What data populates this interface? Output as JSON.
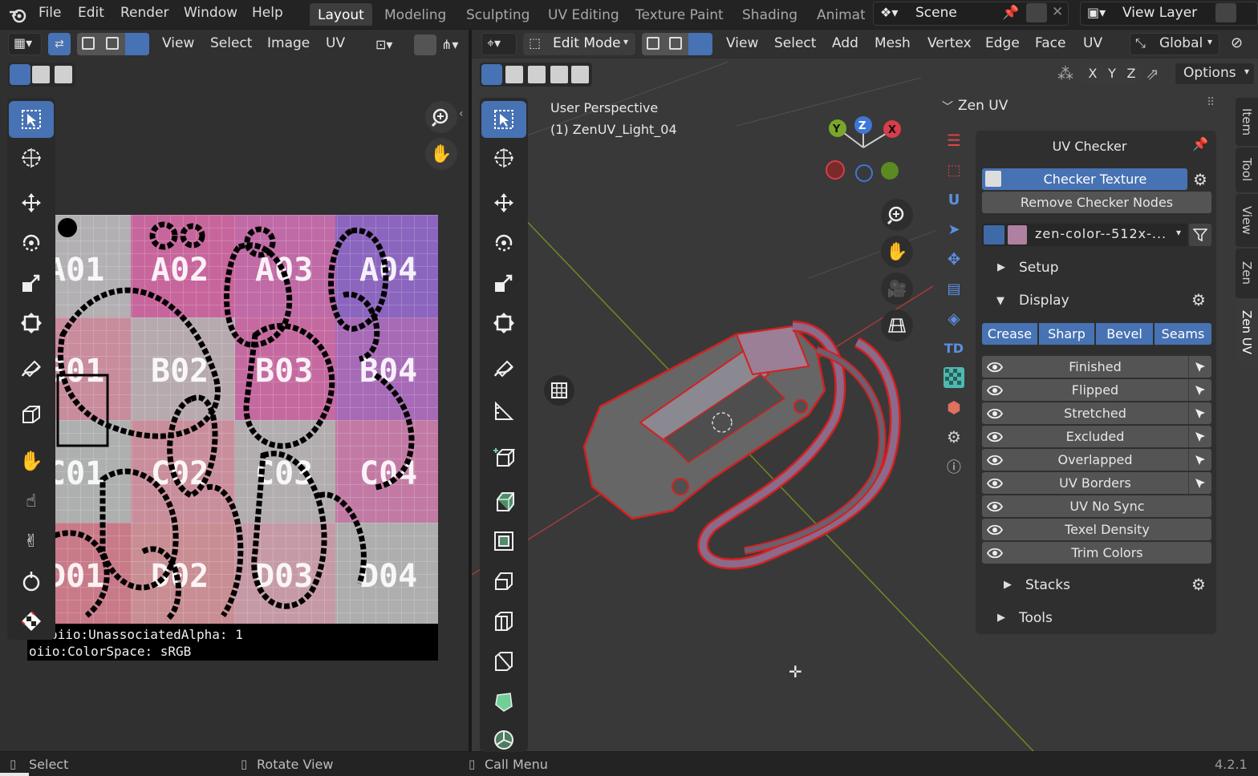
{
  "menubar": {
    "items": [
      "File",
      "Edit",
      "Render",
      "Window",
      "Help"
    ],
    "workspaces": [
      "Layout",
      "Modeling",
      "Sculpting",
      "UV Editing",
      "Texture Paint",
      "Shading",
      "Animati"
    ],
    "scene": "Scene",
    "view_layer": "View Layer"
  },
  "uv_editor": {
    "menus": [
      "View",
      "Select",
      "Image",
      "UV"
    ],
    "tile_labels": [
      "A01",
      "A02",
      "A03",
      "A04",
      "B01",
      "B02",
      "B03",
      "B04",
      "C01",
      "C02",
      "C03",
      "C04",
      "D01",
      "D02",
      "D03",
      "D04"
    ],
    "meta_lines": [
      "oiio:UnassociatedAlpha: 1",
      "oiio:ColorSpace: sRGB"
    ]
  },
  "viewport": {
    "mode": "Edit Mode",
    "menus": [
      "View",
      "Select",
      "Add",
      "Mesh",
      "Vertex",
      "Edge",
      "Face",
      "UV"
    ],
    "transform": "Global",
    "options": "Options",
    "axes": [
      "X",
      "Y",
      "Z"
    ],
    "overlay_title": "User Perspective",
    "overlay_object": "(1) ZenUV_Light_04",
    "gizmo": {
      "x": "X",
      "y": "Y",
      "z": "Z"
    }
  },
  "zen_uv": {
    "title": "Zen UV",
    "checker_title": "UV Checker",
    "checker_texture": "Checker Texture",
    "remove_nodes": "Remove Checker Nodes",
    "image_name": "zen-color--512x-...",
    "setup": "Setup",
    "display": "Display",
    "segments": [
      "Crease",
      "Sharp",
      "Bevel",
      "Seams"
    ],
    "display_items": [
      {
        "label": "Finished",
        "pick": true
      },
      {
        "label": "Flipped",
        "pick": true
      },
      {
        "label": "Stretched",
        "pick": true
      },
      {
        "label": "Excluded",
        "pick": true
      },
      {
        "label": "Overlapped",
        "pick": true
      },
      {
        "label": "UV Borders",
        "pick": true
      },
      {
        "label": "UV No Sync",
        "pick": false
      },
      {
        "label": "Texel Density",
        "pick": false
      },
      {
        "label": "Trim Colors",
        "pick": false
      }
    ],
    "stacks": "Stacks",
    "tools": "Tools",
    "td_label": "TD"
  },
  "side_tabs": [
    "Item",
    "Tool",
    "View",
    "Zen",
    "Zen UV"
  ],
  "status": {
    "select": "Select",
    "rotate": "Rotate View",
    "call_menu": "Call Menu",
    "version": "4.2.1"
  },
  "colors": {
    "accent": "#4772b3",
    "mesh": "#d42020",
    "bg": "#393939"
  }
}
